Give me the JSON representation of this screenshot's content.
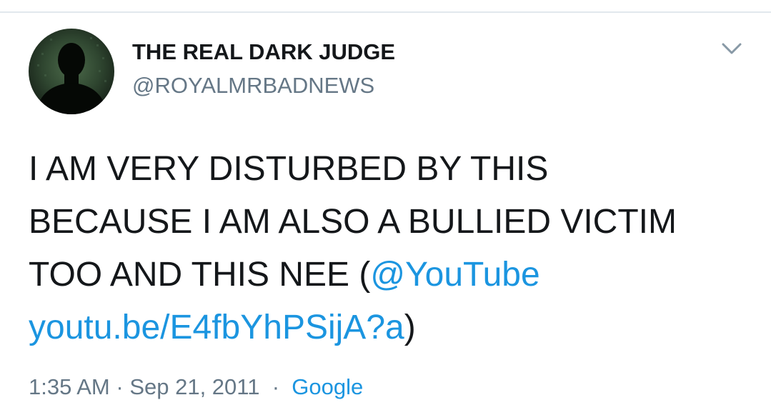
{
  "user": {
    "display_name": "THE REAL DARK JUDGE",
    "handle": "@ROYALMRBADNEWS"
  },
  "tweet": {
    "line1": "I AM VERY DISTURBED BY THIS",
    "line2": "BECAUSE I AM ALSO A BULLIED VICTIM",
    "line3_text": "TOO AND THIS NEE (",
    "mention": "@YouTube",
    "url": "youtu.be/E4fbYhPSijA?a",
    "closing": ")"
  },
  "meta": {
    "time": "1:35 AM",
    "separator": "·",
    "date": "Sep 21, 2011",
    "source": "Google"
  },
  "icons": {
    "menu": "chevron-down-icon",
    "avatar": "avatar-silhouette"
  },
  "colors": {
    "link": "#1b95e0",
    "secondary_text": "#657786",
    "primary_text": "#14171a",
    "divider": "#e1e8ed"
  }
}
